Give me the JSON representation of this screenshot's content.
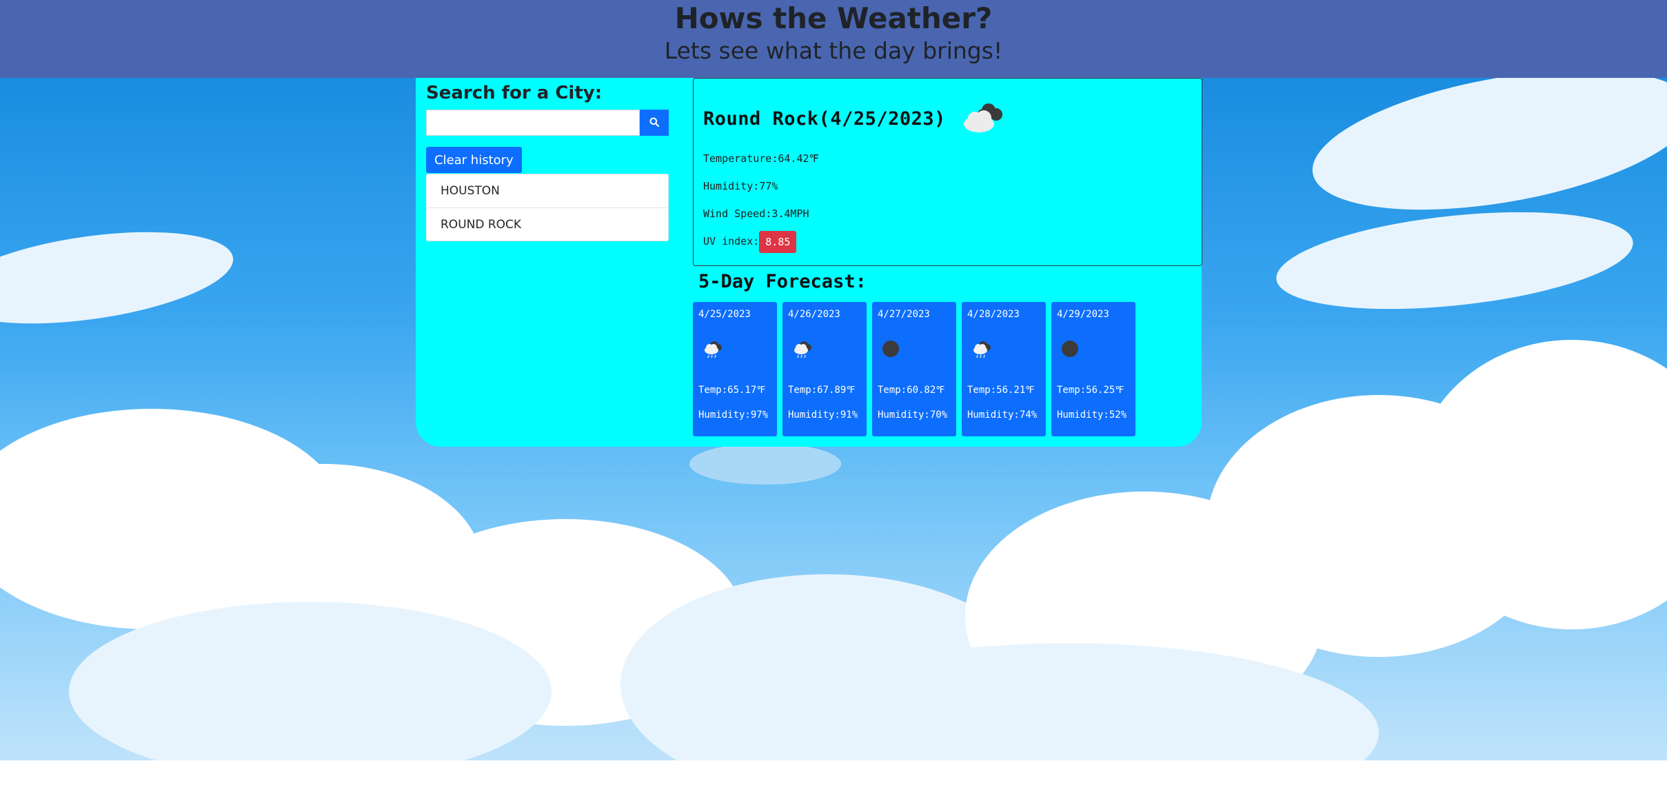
{
  "header": {
    "title": "Hows the Weather?",
    "subtitle": "Lets see what the day brings!"
  },
  "search": {
    "heading": "Search for a City:",
    "placeholder": "",
    "value": "",
    "button_icon": "search-icon",
    "clear_label": "Clear history",
    "history": [
      "HOUSTON",
      "ROUND ROCK"
    ]
  },
  "current": {
    "title": "Round Rock(4/25/2023)",
    "icon": "cloudy-icon",
    "temperature": "Temperature:64.42℉",
    "humidity": "Humidity:77%",
    "wind": "Wind Speed:3.4MPH",
    "uv_label": "UV index:",
    "uv_value": "8.85",
    "uv_color": "#dc3545"
  },
  "forecast": {
    "heading": "5-Day Forecast:",
    "days": [
      {
        "date": "4/25/2023",
        "icon": "rain-cloud-icon",
        "temp": "Temp:65.17℉",
        "humidity": "Humidity:97%"
      },
      {
        "date": "4/26/2023",
        "icon": "rain-cloud-icon",
        "temp": "Temp:67.89℉",
        "humidity": "Humidity:91%"
      },
      {
        "date": "4/27/2023",
        "icon": "dark-cloud-icon",
        "temp": "Temp:60.82℉",
        "humidity": "Humidity:70%"
      },
      {
        "date": "4/28/2023",
        "icon": "rain-cloud-icon",
        "temp": "Temp:56.21℉",
        "humidity": "Humidity:74%"
      },
      {
        "date": "4/29/2023",
        "icon": "dark-cloud-icon",
        "temp": "Temp:56.25℉",
        "humidity": "Humidity:52%"
      }
    ]
  },
  "colors": {
    "header_bg": "#4a66b0",
    "panel_bg": "#00ffff",
    "button_blue": "#0d6efd",
    "uv_badge": "#dc3545"
  }
}
